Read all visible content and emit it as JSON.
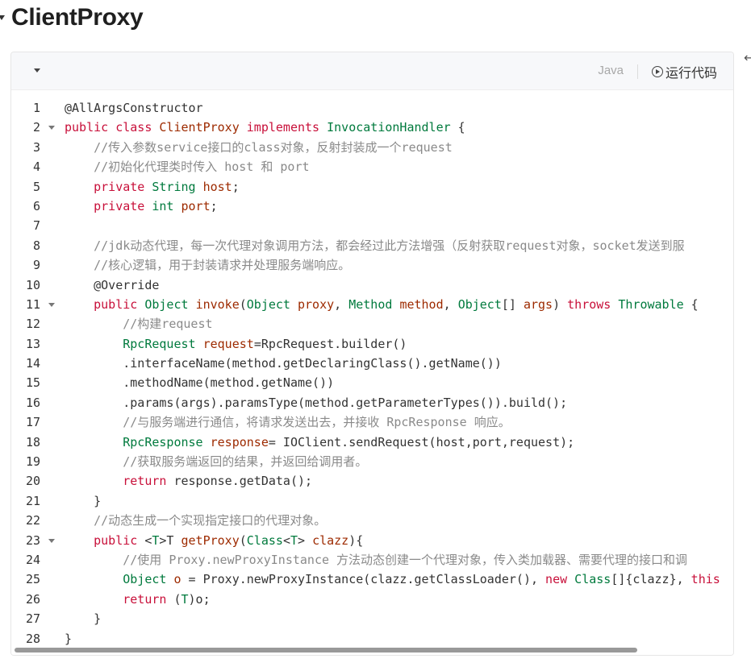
{
  "heading": {
    "title": "ClientProxy"
  },
  "toolbar": {
    "language": "Java",
    "run_label": "运行代码"
  },
  "colors": {
    "keyword": "#c8103a",
    "type": "#007a3d",
    "identifier": "#9d2a00",
    "comment": "#8a8a8a"
  },
  "icons": {
    "collapse": "chevron-down-icon",
    "run": "play-circle-icon",
    "back": "arrow-left-icon"
  },
  "code": {
    "lines": [
      {
        "n": "1",
        "fold": false,
        "tokens": [
          [
            "an",
            "@AllArgsConstructor"
          ]
        ]
      },
      {
        "n": "2",
        "fold": true,
        "tokens": [
          [
            "kw",
            "public"
          ],
          [
            "pl",
            " "
          ],
          [
            "kw",
            "class"
          ],
          [
            "pl",
            " "
          ],
          [
            "fn",
            "ClientProxy"
          ],
          [
            "pl",
            " "
          ],
          [
            "kw",
            "implements"
          ],
          [
            "pl",
            " "
          ],
          [
            "ty",
            "InvocationHandler"
          ],
          [
            "pl",
            " {"
          ]
        ]
      },
      {
        "n": "3",
        "fold": false,
        "tokens": [
          [
            "pl",
            "    "
          ],
          [
            "cm",
            "//传入参数service接口的class对象，反射封装成一个request"
          ]
        ]
      },
      {
        "n": "4",
        "fold": false,
        "tokens": [
          [
            "pl",
            "    "
          ],
          [
            "cm",
            "//初始化代理类时传入 host 和 port"
          ]
        ]
      },
      {
        "n": "5",
        "fold": false,
        "tokens": [
          [
            "pl",
            "    "
          ],
          [
            "kw",
            "private"
          ],
          [
            "pl",
            " "
          ],
          [
            "ty",
            "String"
          ],
          [
            "pl",
            " "
          ],
          [
            "fn",
            "host"
          ],
          [
            "pl",
            ";"
          ]
        ]
      },
      {
        "n": "6",
        "fold": false,
        "tokens": [
          [
            "pl",
            "    "
          ],
          [
            "kw",
            "private"
          ],
          [
            "pl",
            " "
          ],
          [
            "ty",
            "int"
          ],
          [
            "pl",
            " "
          ],
          [
            "fn",
            "port"
          ],
          [
            "pl",
            ";"
          ]
        ]
      },
      {
        "n": "7",
        "fold": false,
        "tokens": []
      },
      {
        "n": "8",
        "fold": false,
        "tokens": [
          [
            "pl",
            "    "
          ],
          [
            "cm",
            "//jdk动态代理，每一次代理对象调用方法，都会经过此方法增强（反射获取request对象，socket发送到服"
          ]
        ]
      },
      {
        "n": "9",
        "fold": false,
        "tokens": [
          [
            "pl",
            "    "
          ],
          [
            "cm",
            "//核心逻辑，用于封装请求并处理服务端响应。"
          ]
        ]
      },
      {
        "n": "10",
        "fold": false,
        "tokens": [
          [
            "pl",
            "    "
          ],
          [
            "an",
            "@Override"
          ]
        ]
      },
      {
        "n": "11",
        "fold": true,
        "tokens": [
          [
            "pl",
            "    "
          ],
          [
            "kw",
            "public"
          ],
          [
            "pl",
            " "
          ],
          [
            "ty",
            "Object"
          ],
          [
            "pl",
            " "
          ],
          [
            "fn",
            "invoke"
          ],
          [
            "pl",
            "("
          ],
          [
            "ty",
            "Object"
          ],
          [
            "pl",
            " "
          ],
          [
            "fn",
            "proxy"
          ],
          [
            "pl",
            ", "
          ],
          [
            "ty",
            "Method"
          ],
          [
            "pl",
            " "
          ],
          [
            "fn",
            "method"
          ],
          [
            "pl",
            ", "
          ],
          [
            "ty",
            "Object"
          ],
          [
            "pl",
            "[] "
          ],
          [
            "fn",
            "args"
          ],
          [
            "pl",
            ") "
          ],
          [
            "kw",
            "throws"
          ],
          [
            "pl",
            " "
          ],
          [
            "ty",
            "Throwable"
          ],
          [
            "pl",
            " {"
          ]
        ]
      },
      {
        "n": "12",
        "fold": false,
        "tokens": [
          [
            "pl",
            "        "
          ],
          [
            "cm",
            "//构建request"
          ]
        ]
      },
      {
        "n": "13",
        "fold": false,
        "tokens": [
          [
            "pl",
            "        "
          ],
          [
            "ty",
            "RpcRequest"
          ],
          [
            "pl",
            " "
          ],
          [
            "fn",
            "request"
          ],
          [
            "pl",
            "=RpcRequest.builder()"
          ]
        ]
      },
      {
        "n": "14",
        "fold": false,
        "tokens": [
          [
            "pl",
            "        .interfaceName(method.getDeclaringClass().getName())"
          ]
        ]
      },
      {
        "n": "15",
        "fold": false,
        "tokens": [
          [
            "pl",
            "        .methodName(method.getName())"
          ]
        ]
      },
      {
        "n": "16",
        "fold": false,
        "tokens": [
          [
            "pl",
            "        .params(args).paramsType(method.getParameterTypes()).build();"
          ]
        ]
      },
      {
        "n": "17",
        "fold": false,
        "tokens": [
          [
            "pl",
            "        "
          ],
          [
            "cm",
            "//与服务端进行通信，将请求发送出去，并接收 RpcResponse 响应。"
          ]
        ]
      },
      {
        "n": "18",
        "fold": false,
        "tokens": [
          [
            "pl",
            "        "
          ],
          [
            "ty",
            "RpcResponse"
          ],
          [
            "pl",
            " "
          ],
          [
            "fn",
            "response"
          ],
          [
            "pl",
            "= IOClient.sendRequest(host,port,request);"
          ]
        ]
      },
      {
        "n": "19",
        "fold": false,
        "tokens": [
          [
            "pl",
            "        "
          ],
          [
            "cm",
            "//获取服务端返回的结果，并返回给调用者。"
          ]
        ]
      },
      {
        "n": "20",
        "fold": false,
        "tokens": [
          [
            "pl",
            "        "
          ],
          [
            "kw",
            "return"
          ],
          [
            "pl",
            " response.getData();"
          ]
        ]
      },
      {
        "n": "21",
        "fold": false,
        "tokens": [
          [
            "pl",
            "    }"
          ]
        ]
      },
      {
        "n": "22",
        "fold": false,
        "tokens": [
          [
            "pl",
            "    "
          ],
          [
            "cm",
            "//动态生成一个实现指定接口的代理对象。"
          ]
        ]
      },
      {
        "n": "23",
        "fold": true,
        "tokens": [
          [
            "pl",
            "    "
          ],
          [
            "kw",
            "public"
          ],
          [
            "pl",
            " <"
          ],
          [
            "ty",
            "T"
          ],
          [
            "pl",
            ">T "
          ],
          [
            "fn",
            "getProxy"
          ],
          [
            "pl",
            "("
          ],
          [
            "ty",
            "Class"
          ],
          [
            "pl",
            "<"
          ],
          [
            "ty",
            "T"
          ],
          [
            "pl",
            "> "
          ],
          [
            "fn",
            "clazz"
          ],
          [
            "pl",
            "){"
          ]
        ]
      },
      {
        "n": "24",
        "fold": false,
        "tokens": [
          [
            "pl",
            "        "
          ],
          [
            "cm",
            "//使用 Proxy.newProxyInstance 方法动态创建一个代理对象，传入类加载器、需要代理的接口和调"
          ]
        ]
      },
      {
        "n": "25",
        "fold": false,
        "tokens": [
          [
            "pl",
            "        "
          ],
          [
            "ty",
            "Object"
          ],
          [
            "pl",
            " "
          ],
          [
            "fn",
            "o"
          ],
          [
            "pl",
            " = Proxy.newProxyInstance(clazz.getClassLoader(), "
          ],
          [
            "kw",
            "new"
          ],
          [
            "pl",
            " "
          ],
          [
            "ty",
            "Class"
          ],
          [
            "pl",
            "[]{clazz}, "
          ],
          [
            "kw",
            "this"
          ]
        ]
      },
      {
        "n": "26",
        "fold": false,
        "tokens": [
          [
            "pl",
            "        "
          ],
          [
            "kw",
            "return"
          ],
          [
            "pl",
            " ("
          ],
          [
            "ty",
            "T"
          ],
          [
            "pl",
            ")o;"
          ]
        ]
      },
      {
        "n": "27",
        "fold": false,
        "tokens": [
          [
            "pl",
            "    }"
          ]
        ]
      },
      {
        "n": "28",
        "fold": false,
        "tokens": [
          [
            "pl",
            "}"
          ]
        ]
      }
    ]
  }
}
